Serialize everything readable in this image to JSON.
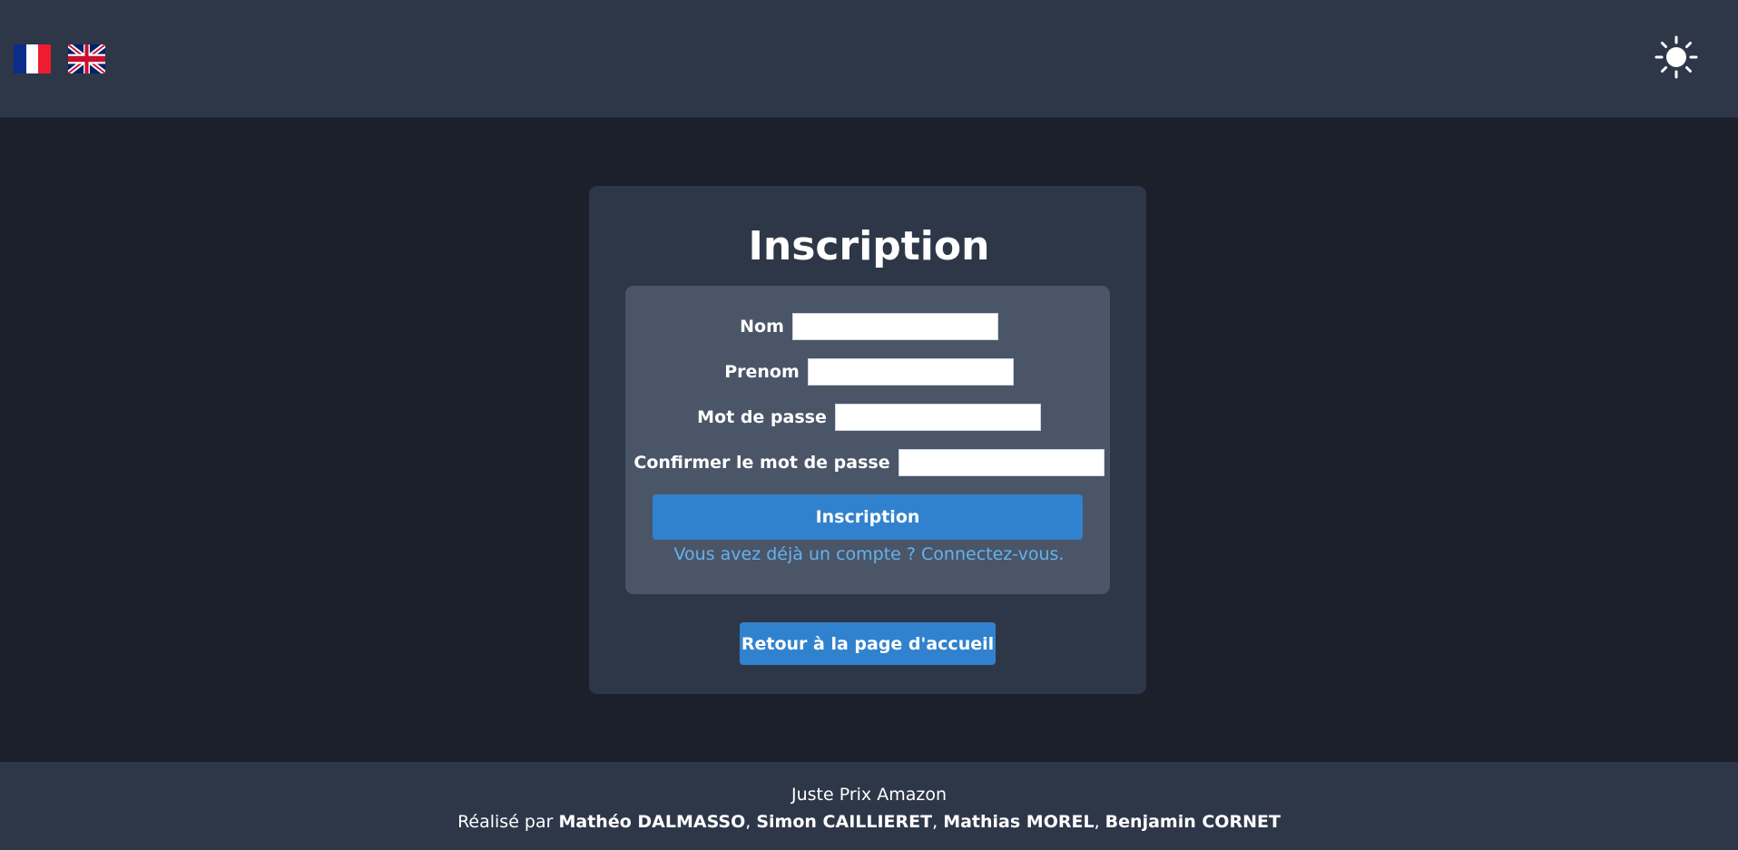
{
  "header": {
    "flags": [
      {
        "name": "French",
        "icon": "flag-fr-icon"
      },
      {
        "name": "English",
        "icon": "flag-uk-icon"
      }
    ],
    "theme_icon": "sun-icon"
  },
  "form": {
    "title": "Inscription",
    "fields": [
      {
        "label": "Nom",
        "value": "",
        "placeholder": ""
      },
      {
        "label": "Prenom",
        "value": "",
        "placeholder": ""
      },
      {
        "label": "Mot de passe",
        "value": "",
        "placeholder": ""
      },
      {
        "label": "Confirmer le mot de passe",
        "value": "",
        "placeholder": ""
      }
    ],
    "submit_label": "Inscription",
    "login_link": "Vous avez déjà un compte ? Connectez-vous."
  },
  "home_button_label": "Retour à la page d'accueil",
  "footer": {
    "title": "Juste Prix Amazon",
    "credits_prefix": "Réalisé par",
    "authors": [
      "Mathéo DALMASSO",
      "Simon CAILLIERET",
      "Mathias MOREL",
      "Benjamin CORNET"
    ]
  },
  "colors": {
    "background": "#1b202b",
    "panel": "#2e3748",
    "form_box": "#4a5568",
    "accent": "#3182ce",
    "link": "#63b3ed"
  }
}
